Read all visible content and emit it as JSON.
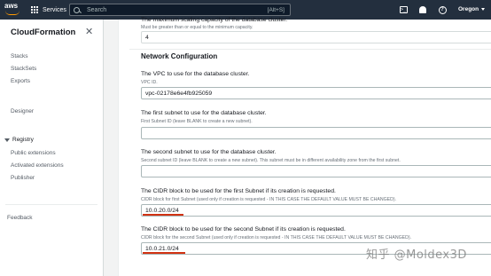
{
  "topbar": {
    "logo_text": "aws",
    "services_label": "Services",
    "search_placeholder": "Search",
    "search_shortcut": "[Alt+S]",
    "region": "Oregon"
  },
  "sidebar": {
    "title": "CloudFormation",
    "items": [
      {
        "label": "Stacks"
      },
      {
        "label": "StackSets"
      },
      {
        "label": "Exports"
      }
    ],
    "designer": "Designer",
    "registry": {
      "label": "Registry",
      "items": [
        {
          "label": "Public extensions"
        },
        {
          "label": "Activated extensions"
        },
        {
          "label": "Publisher"
        }
      ]
    },
    "feedback": "Feedback"
  },
  "form": {
    "cut_label": "The maximum scaling capacity of the database cluster.",
    "max_capacity": {
      "description": "Must be greater than or equal to the minimum capacity.",
      "value": "4"
    },
    "network_title": "Network Configuration",
    "vpc": {
      "label": "The VPC to use for the database cluster.",
      "description": "VPC ID.",
      "value": "vpc-02178e6e4fb925059"
    },
    "subnet1": {
      "label": "The first subnet to use for the database cluster.",
      "description": "First Subnet ID (leave BLANK to create a new subnet).",
      "value": ""
    },
    "subnet2": {
      "label": "The second subnet to use for the database cluster.",
      "description": "Second subnet ID (leave BLANK to create a new subnet). This subnet must be in different availability zone from the first subnet.",
      "value": ""
    },
    "cidr1": {
      "label": "The CIDR block to be used for the first Subnet if its creation is requested.",
      "description": "CIDR block for first Subnet (used only if creation is requested - IN THIS CASE THE DEFAULT VALUE MUST BE CHANGED).",
      "value": "10.0.20.0/24"
    },
    "cidr2": {
      "label": "The CIDR block to be used for the second Subnet if its creation is requested.",
      "description": "CIDR block for the second Subnet (used only if creation is requested - IN THIS CASE THE DEFAULT VALUE MUST BE CHANGED).",
      "value": "10.0.21.0/24"
    }
  },
  "watermark": "知乎 @Moldex3D",
  "colors": {
    "topbar_bg": "#232f3e",
    "logo_accent": "#ff9900",
    "highlight_underline": "#d13212",
    "content_bg": "#f2f3f3"
  },
  "icons": [
    "grid-icon",
    "search-icon",
    "cloudshell-icon",
    "bell-icon",
    "help-icon",
    "close-icon",
    "caret-down-icon"
  ]
}
